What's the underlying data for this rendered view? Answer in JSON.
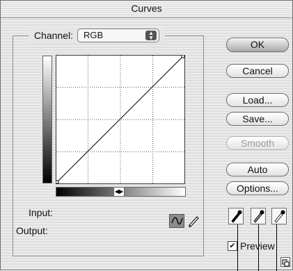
{
  "window": {
    "title": "Curves"
  },
  "channel": {
    "label": "Channel:",
    "selected": "RGB"
  },
  "buttons": {
    "ok": "OK",
    "cancel": "Cancel",
    "load": "Load...",
    "save": "Save...",
    "smooth": "Smooth",
    "auto": "Auto",
    "options": "Options..."
  },
  "fields": {
    "input_label": "Input:",
    "output_label": "Output:"
  },
  "preview": {
    "label": "Preview",
    "checked": true
  },
  "icons": {
    "channel_arrows": "updown-arrows-icon",
    "slider_arrows": "left-right-arrows-icon",
    "curve_tool": "curve-tool-icon",
    "pencil_tool": "pencil-tool-icon",
    "eyedroppers": [
      "black-point-eyedropper-icon",
      "gray-point-eyedropper-icon",
      "white-point-eyedropper-icon"
    ],
    "resize": "resize-grip-icon"
  }
}
